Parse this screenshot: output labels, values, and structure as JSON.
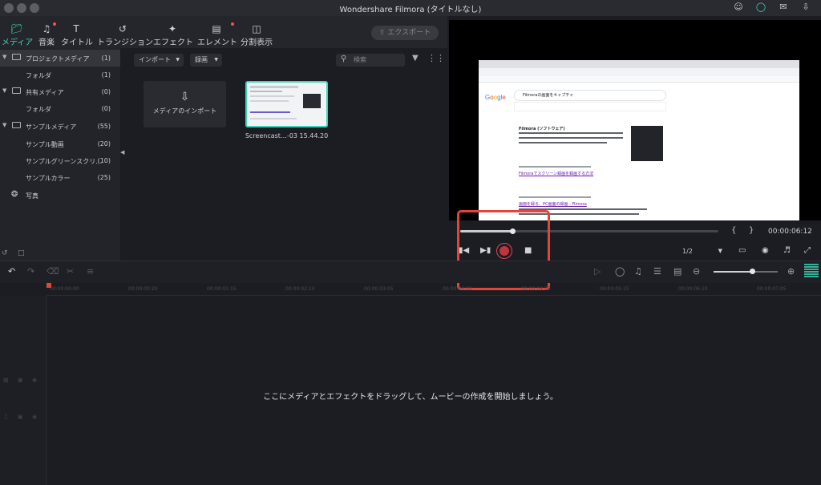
{
  "window": {
    "title": "Wondershare Filmora (タイトルなし)"
  },
  "toolbar": {
    "tabs": [
      {
        "label": "メディア",
        "icon": "folder-icon"
      },
      {
        "label": "音楽",
        "icon": "music-note-icon"
      },
      {
        "label": "タイトル",
        "icon": "title-t-icon"
      },
      {
        "label": "トランジション",
        "icon": "transition-icon"
      },
      {
        "label": "エフェクト",
        "icon": "effect-sparkle-icon"
      },
      {
        "label": "エレメント",
        "icon": "element-icon"
      },
      {
        "label": "分割表示",
        "icon": "split-screen-icon"
      }
    ],
    "export_label": "エクスポート"
  },
  "sidebar": {
    "items": [
      {
        "label": "プロジェクトメディア",
        "count": "(1)"
      },
      {
        "label": "フォルダ",
        "count": "(1)"
      },
      {
        "label": "共有メディア",
        "count": "(0)"
      },
      {
        "label": "フォルダ",
        "count": "(0)"
      },
      {
        "label": "サンプルメディア",
        "count": "(55)"
      },
      {
        "label": "サンプル動画",
        "count": "(20)"
      },
      {
        "label": "サンプルグリーンスクリ…",
        "count": "(10)"
      },
      {
        "label": "サンプルカラー",
        "count": "(25)"
      },
      {
        "label": "写真",
        "count": ""
      }
    ]
  },
  "media": {
    "import_dropdown": "インポート",
    "record_dropdown": "録画",
    "search_placeholder": "検索",
    "import_tile_label": "メディアのインポート",
    "clip_name": "Screencast…-03 15.44.20"
  },
  "preview": {
    "browser": {
      "search_query": "Filmoraの画面をキャプチャ",
      "heading": "Filmora (ソフトウェア)",
      "link1": "Filmoraでスクリーン録画を録画する方法",
      "link2": "画面を録る、PC画面の録画 - Filmora"
    },
    "brace_left": "{",
    "brace_right": "}",
    "timecode": "00:00:06:12",
    "ratio": "1/2",
    "colors": {
      "accent": "#3dd5b9",
      "highlight": "#e2453a"
    }
  },
  "timeline": {
    "ticks": [
      "00:00:00:00",
      "00:00:00:20",
      "00:00:01:15",
      "00:00:02:10",
      "00:00:03:05",
      "00:00:04:00",
      "00:00:04:20",
      "00:00:05:15",
      "00:00:06:10",
      "00:00:07:05"
    ],
    "drop_hint": "ここにメディアとエフェクトをドラッグして、ムービーの作成を開始しましょう。"
  }
}
